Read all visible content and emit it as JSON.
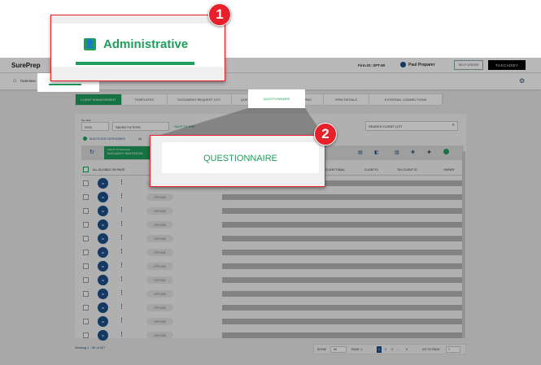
{
  "header": {
    "logo": "SurePrep",
    "firm_id": "Firm ID: SPT-80",
    "user": "Paul Preparer",
    "help": "HELP CENTER",
    "taxcaddy": "TAXCADDY"
  },
  "nav": {
    "overview": "Overview"
  },
  "tabs": [
    "CLIENT MANAGEMENT",
    "TEMPLATES",
    "DOCUMENT REQUEST LIST",
    "QUESTIONNAIRE",
    "TAX RETURNS",
    "FIRM DETAILS",
    "EXTERNAL CONNECTIONS"
  ],
  "filters": {
    "tax_year_label": "Tax Year",
    "tax_year": "2020",
    "saved_filters": "SAVED FILTERS",
    "save_filter": "SAVE FILTER",
    "search_placeholder": "SEARCH CLIENT LIST",
    "add_filter": "ADD FILTER CATEGORIES",
    "add_filter_count": "(0)"
  },
  "toolbar": {
    "manage_label": "I WANT TO MANAGE",
    "manage_value": "TAXCADDY INVITATION"
  },
  "columns": {
    "all": "ALL ELIGIBLE ON PAGE",
    "email": "CLIENT EMAIL",
    "client_id": "CLIENT ID",
    "tax_client_id": "TAX CLIENT ID",
    "owner": "OWNER"
  },
  "row_avatar": "00",
  "row_status": "OFFLINE",
  "footer": {
    "viewing": "Viewing 1 - 50 of 427",
    "show": "SHOW",
    "show_value": "50",
    "page": "PAGE: 1",
    "pages": [
      "1",
      "2",
      "3",
      "...",
      "9"
    ],
    "goto": "GO TO PAGE:",
    "goto_value": "1"
  },
  "callout1": {
    "number": "1",
    "label": "Administrative"
  },
  "callout2": {
    "number": "2",
    "label": "QUESTIONNAIRE"
  }
}
